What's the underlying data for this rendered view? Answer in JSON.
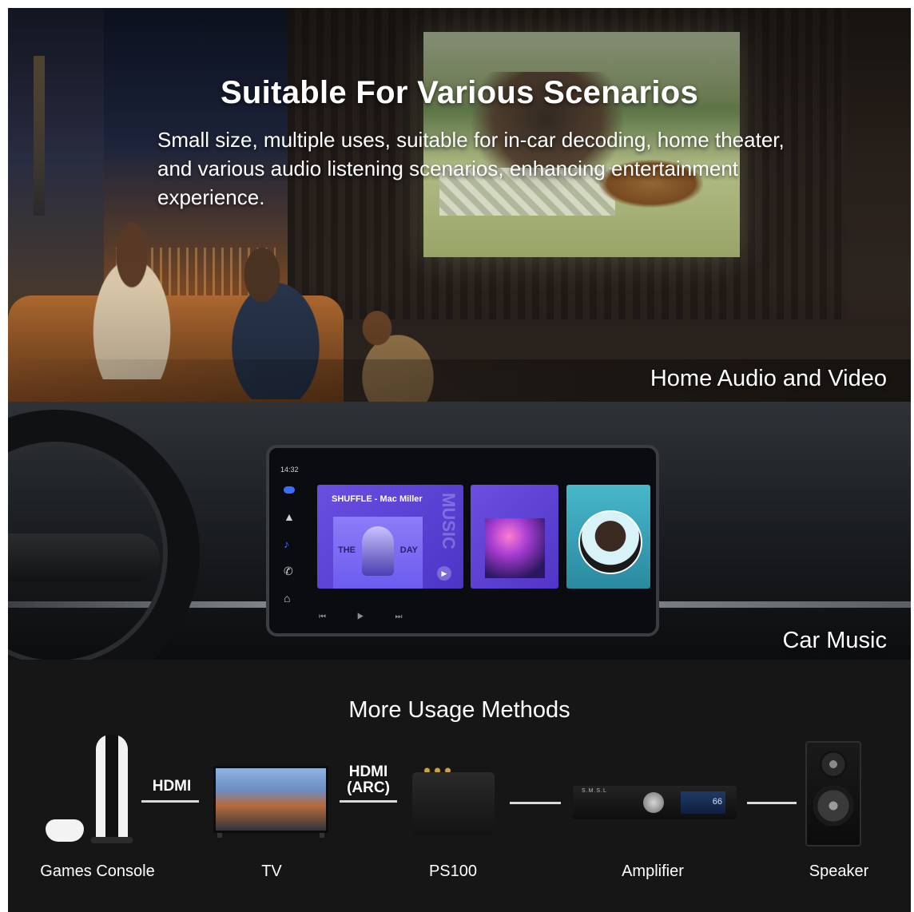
{
  "home": {
    "title": "Suitable For Various Scenarios",
    "subtitle": "Small size, multiple uses, suitable for in-car decoding, home theater, and various audio listening scenarios, enhancing entertainment experience.",
    "caption": "Home Audio and Video"
  },
  "car": {
    "caption": "Car Music",
    "screen": {
      "time": "14:32",
      "card1_label": "SHUFFLE - Mac Miller",
      "card1_art_left": "THE",
      "card1_art_right": "DAY",
      "card1_side_text": "MUSIC",
      "controls": "⏮ ▶ ⏭"
    }
  },
  "usage": {
    "title": "More Usage Methods",
    "devices": [
      "Games Console",
      "TV",
      "PS100",
      "Amplifier",
      "Speaker"
    ],
    "connections": [
      "HDMI",
      "HDMI\n(ARC)"
    ],
    "amp_brand": "S.M.S.L",
    "amp_display": "66"
  }
}
